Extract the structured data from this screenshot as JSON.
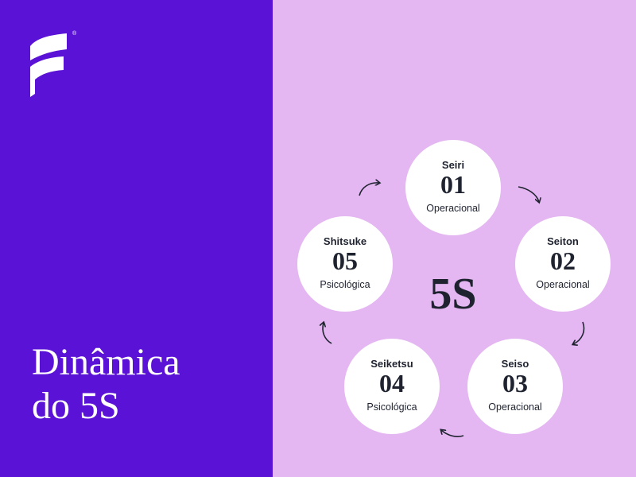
{
  "brand": {
    "registered_mark": "®",
    "logo_icon": "brand-logo-icon"
  },
  "title": {
    "line1": "Dinâmica",
    "line2": "do 5S"
  },
  "center_label": "5S",
  "steps": [
    {
      "name": "Seiri",
      "number": "01",
      "type": "Operacional"
    },
    {
      "name": "Seiton",
      "number": "02",
      "type": "Operacional"
    },
    {
      "name": "Seiso",
      "number": "03",
      "type": "Operacional"
    },
    {
      "name": "Seiketsu",
      "number": "04",
      "type": "Psicológica"
    },
    {
      "name": "Shitsuke",
      "number": "05",
      "type": "Psicológica"
    }
  ],
  "colors": {
    "left_background": "#5a12d6",
    "right_background": "#e4b6f2",
    "circle_fill": "#ffffff",
    "text_dark": "#1f2330",
    "title_text": "#ffffff"
  }
}
